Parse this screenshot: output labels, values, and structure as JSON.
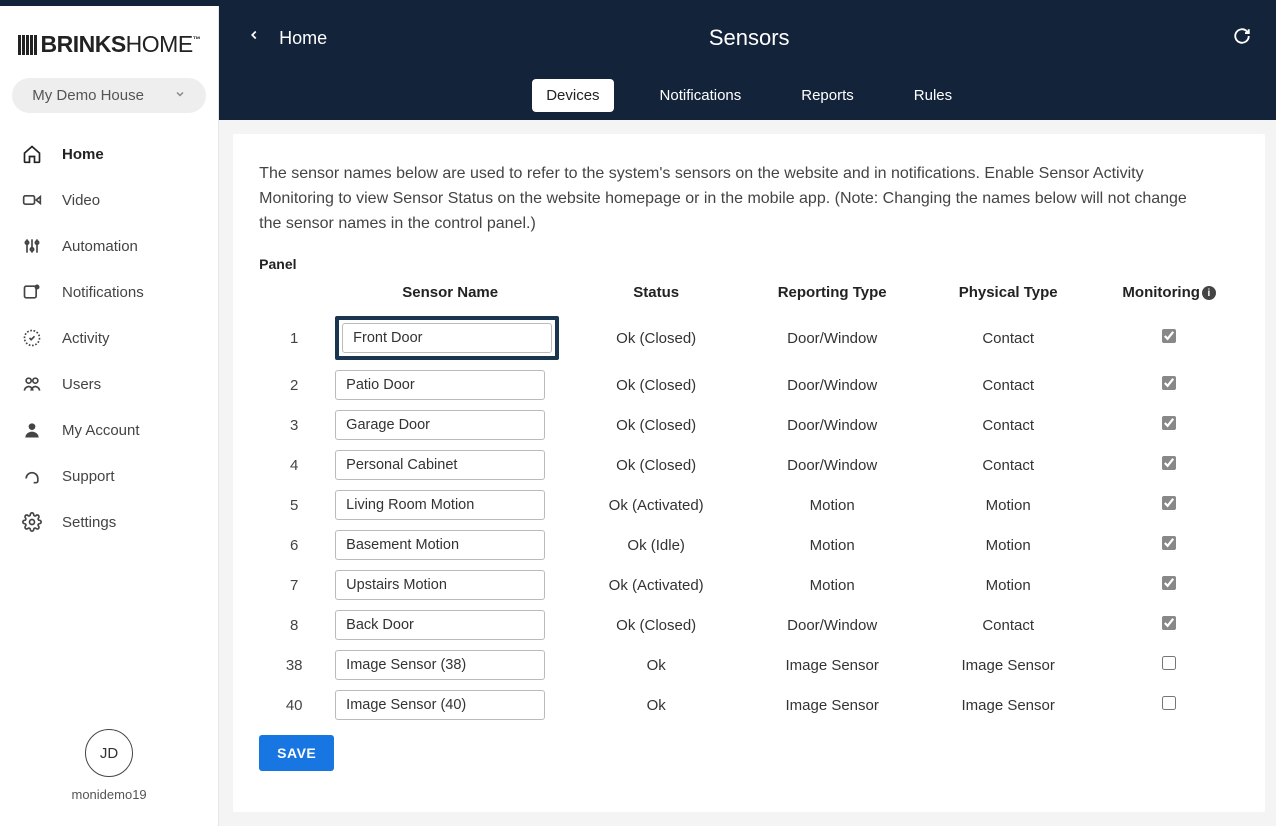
{
  "brand": {
    "name_strong": "BRINKS",
    "name_light": "HOME",
    "tm": "™"
  },
  "house_select": "My Demo House",
  "sidebar": {
    "items": [
      {
        "label": "Home"
      },
      {
        "label": "Video"
      },
      {
        "label": "Automation"
      },
      {
        "label": "Notifications"
      },
      {
        "label": "Activity"
      },
      {
        "label": "Users"
      },
      {
        "label": "My Account"
      },
      {
        "label": "Support"
      },
      {
        "label": "Settings"
      }
    ]
  },
  "user": {
    "initials": "JD",
    "name": "monidemo19"
  },
  "header": {
    "home": "Home",
    "title": "Sensors",
    "tabs": [
      {
        "label": "Devices",
        "active": true
      },
      {
        "label": "Notifications"
      },
      {
        "label": "Reports"
      },
      {
        "label": "Rules"
      }
    ]
  },
  "intro": "The sensor names below are used to refer to the system's sensors on the website and in notifications. Enable Sensor Activity Monitoring to view Sensor Status on the website homepage or in the mobile app. (Note: Changing the names below will not change the sensor names in the control panel.)",
  "panel_label": "Panel",
  "cols": {
    "name": "Sensor Name",
    "status": "Status",
    "reporting": "Reporting Type",
    "physical": "Physical Type",
    "monitoring": "Monitoring"
  },
  "rows": [
    {
      "num": "1",
      "name": "Front Door",
      "status": "Ok (Closed)",
      "rep": "Door/Window",
      "phys": "Contact",
      "mon": true,
      "hl": true
    },
    {
      "num": "2",
      "name": "Patio Door",
      "status": "Ok (Closed)",
      "rep": "Door/Window",
      "phys": "Contact",
      "mon": true
    },
    {
      "num": "3",
      "name": "Garage Door",
      "status": "Ok (Closed)",
      "rep": "Door/Window",
      "phys": "Contact",
      "mon": true
    },
    {
      "num": "4",
      "name": "Personal Cabinet",
      "status": "Ok (Closed)",
      "rep": "Door/Window",
      "phys": "Contact",
      "mon": true
    },
    {
      "num": "5",
      "name": "Living Room Motion",
      "status": "Ok (Activated)",
      "rep": "Motion",
      "phys": "Motion",
      "mon": true
    },
    {
      "num": "6",
      "name": "Basement Motion",
      "status": "Ok (Idle)",
      "rep": "Motion",
      "phys": "Motion",
      "mon": true
    },
    {
      "num": "7",
      "name": "Upstairs Motion",
      "status": "Ok (Activated)",
      "rep": "Motion",
      "phys": "Motion",
      "mon": true
    },
    {
      "num": "8",
      "name": "Back Door",
      "status": "Ok (Closed)",
      "rep": "Door/Window",
      "phys": "Contact",
      "mon": true
    },
    {
      "num": "38",
      "name": "Image Sensor (38)",
      "status": "Ok",
      "rep": "Image Sensor",
      "phys": "Image Sensor",
      "mon": false
    },
    {
      "num": "40",
      "name": "Image Sensor (40)",
      "status": "Ok",
      "rep": "Image Sensor",
      "phys": "Image Sensor",
      "mon": false
    }
  ],
  "save_label": "SAVE"
}
